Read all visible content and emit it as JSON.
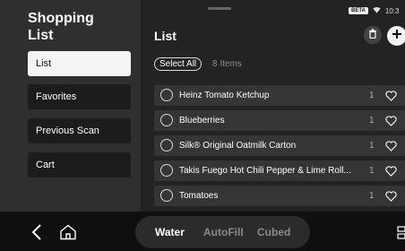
{
  "sidebar": {
    "title_line1": "Shopping",
    "title_line2": "List",
    "items": [
      {
        "label": "List",
        "active": true
      },
      {
        "label": "Favorites",
        "active": false
      },
      {
        "label": "Previous Scan",
        "active": false
      },
      {
        "label": "Cart",
        "active": false
      }
    ]
  },
  "status_bar": {
    "badge": "BETA",
    "time": "10:3"
  },
  "main": {
    "title": "List",
    "select_all_label": "Select All",
    "count_label": "8 Items",
    "items": [
      {
        "name": "Heinz Tomato Ketchup",
        "qty": "1"
      },
      {
        "name": "Blueberries",
        "qty": "1"
      },
      {
        "name": "Silk® Original Oatmilk Carton",
        "qty": "1"
      },
      {
        "name": "Takis Fuego Hot Chili Pepper & Lime Roll...",
        "qty": "1"
      },
      {
        "name": "Tomatoes",
        "qty": "1"
      }
    ]
  },
  "bottom_bar": {
    "tabs": [
      {
        "label": "Water",
        "active": true
      },
      {
        "label": "AutoFill",
        "active": false
      },
      {
        "label": "Cubed",
        "active": false
      }
    ]
  },
  "colors": {
    "accent": "#f4f4f4",
    "background": "#232323",
    "sidebar": "#2f2f2f",
    "inactive_text": "#8a8a8a"
  },
  "icons": [
    "trash-icon",
    "plus-icon",
    "wifi-icon",
    "heart-icon",
    "back-chevron-icon",
    "home-icon",
    "menu-icon"
  ]
}
